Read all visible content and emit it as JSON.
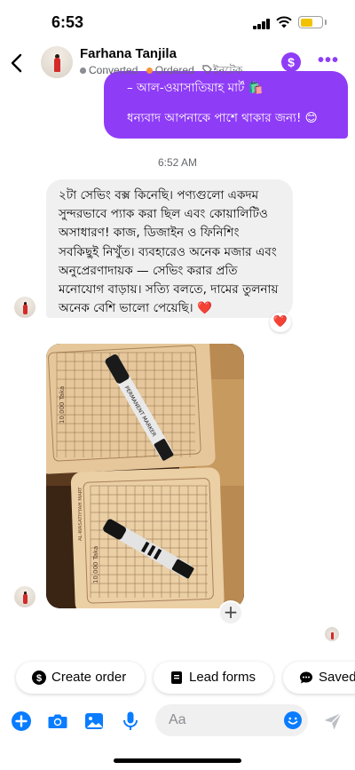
{
  "status_bar": {
    "time": "6:53",
    "battery_level": 0.6
  },
  "header": {
    "contact_name": "Farhana Tanjila",
    "tags": [
      {
        "label": "Converted",
        "color": "#8a8d91"
      },
      {
        "label": "Ordered",
        "color": "#f7923a"
      },
      {
        "label": "ইনটেক"
      }
    ],
    "accent": "#8f3cf7",
    "dollar_symbol": "$",
    "more_symbol": "•••"
  },
  "messages": {
    "outgoing": {
      "line1": "– আল-ওয়াসাতিয়াহ মার্ট 🛍️",
      "line2": "ধন্যবাদ আপনাকে পাশে থাকার জন্য! 😊"
    },
    "timestamp": "6:52 AM",
    "incoming_text": {
      "lines": [
        "২টা সেভিং বক্স কিনেছি। পণ্যগুলো একদম",
        "সুন্দরভাবে প্যাক করা ছিল এবং কোয়ালিটিও",
        "অসাধারণ! কাজ, ডিজাইন ও ফিনিশিং",
        "সবকিছুই নিখুঁত। ব্যবহারেও অনেক মজার এবং",
        "অনুপ্রেরণাদায়ক — সেভিং করার প্রতি",
        "মনোযোগ বাড়ায়। সত্যি বলতে, দামের তুলনায়",
        "অনেক বেশি ভালো পেয়েছি। ❤️"
      ],
      "reaction": "❤️"
    },
    "photo": {
      "board_top_label": "10,000 Taka",
      "board_bottom_label": "10,000 Taka",
      "board_brand": "AL-WASATIYYAH MART",
      "marker_text": "PERMANENT MARKER"
    },
    "add_reaction_symbol": "+"
  },
  "quick_actions": [
    {
      "label": "Create order",
      "icon": "dollar-circle-icon"
    },
    {
      "label": "Lead forms",
      "icon": "form-icon"
    },
    {
      "label": "Saved",
      "icon": "saved-reply-icon"
    }
  ],
  "composer": {
    "placeholder": "Aa"
  }
}
